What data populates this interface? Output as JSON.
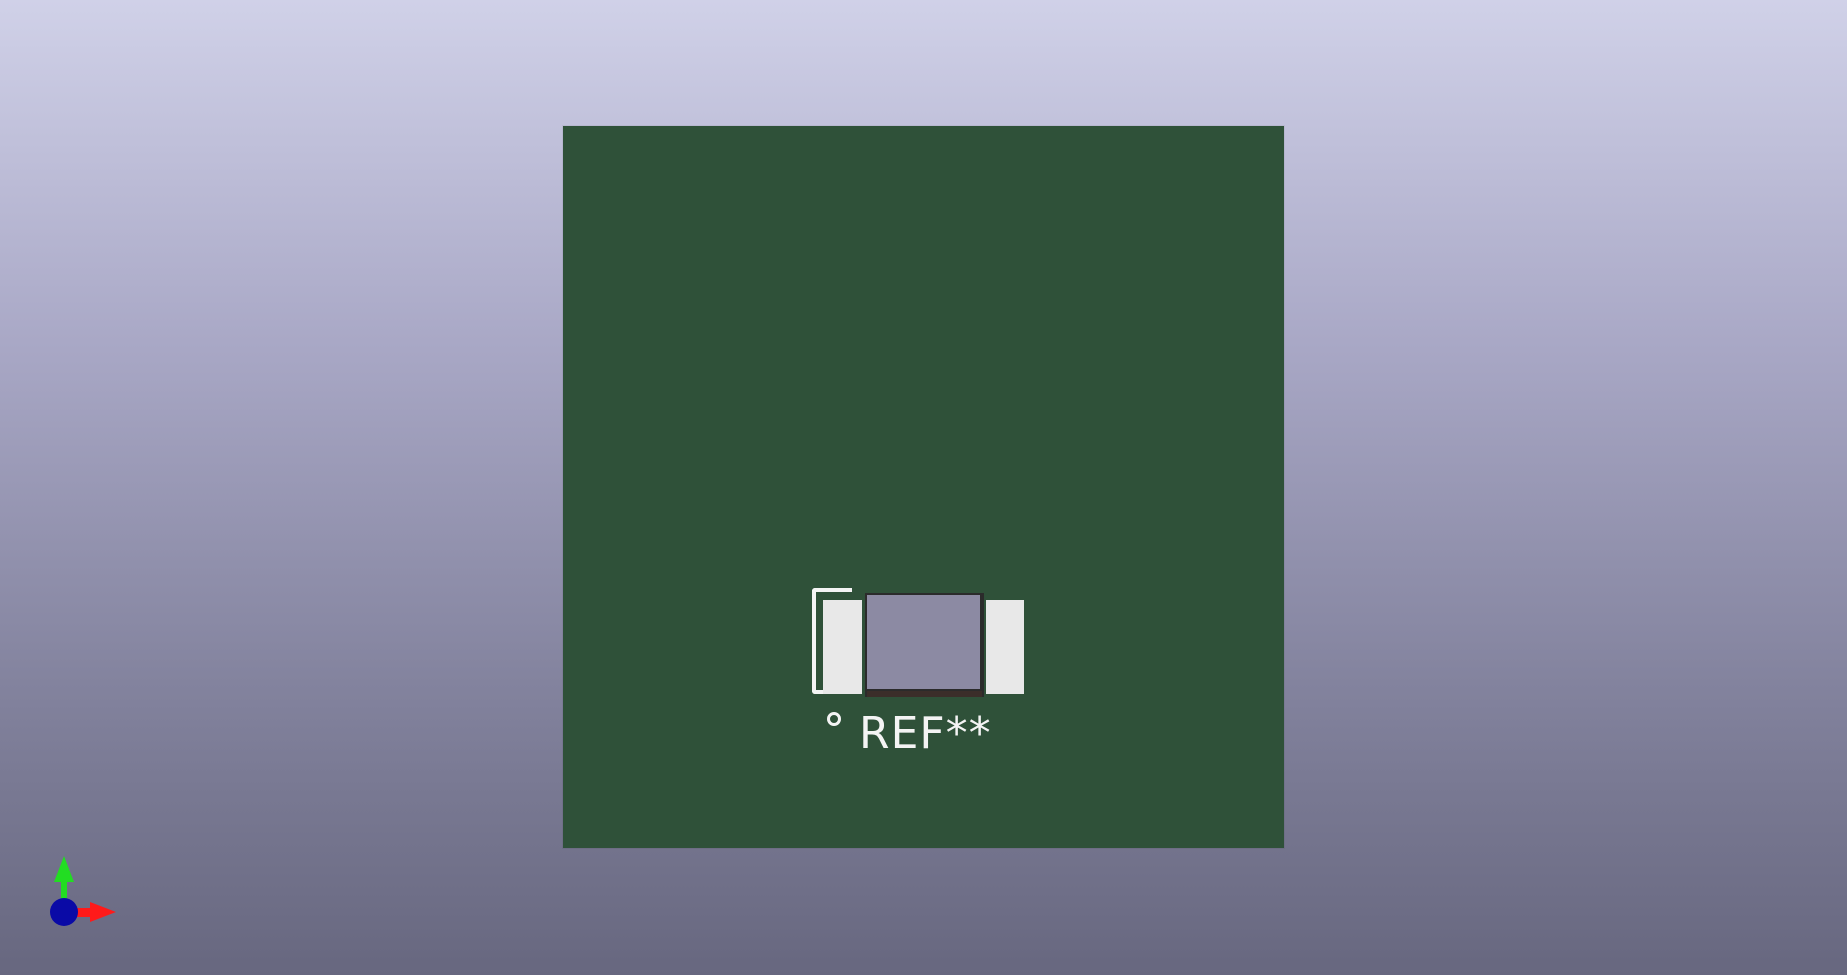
{
  "viewer": {
    "board_color": "#2f5139",
    "silkscreen_color": "#f4f4f4",
    "pad_color": "#e8e8e8",
    "component_body_color": "#8c8aa3"
  },
  "footprint": {
    "reference": "REF**"
  },
  "axis": {
    "x_color": "#ff1a1a",
    "y_color": "#22dd22",
    "z_color": "#0a0aa6"
  }
}
